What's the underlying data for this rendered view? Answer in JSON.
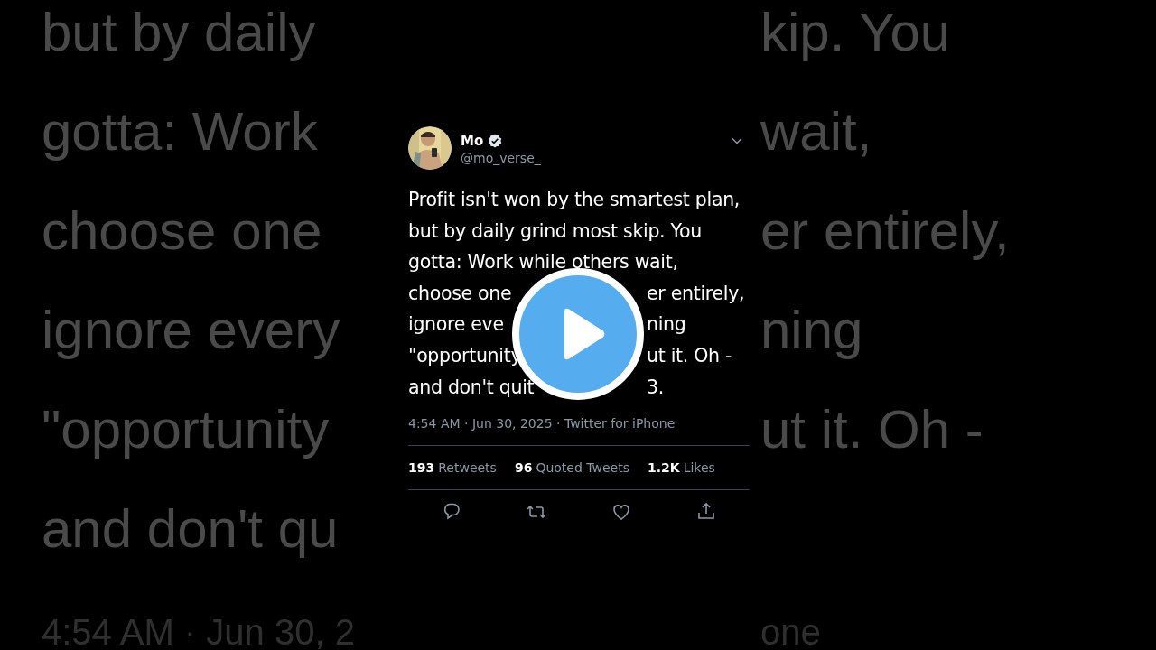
{
  "backdrop": {
    "left_lines": [
      "but by daily",
      "gotta: Work",
      "choose one",
      "ignore every",
      "\"opportunity",
      "and don't qu"
    ],
    "left_footer": "4:54 AM · Jun 30, 2",
    "right_lines": [
      "kip. You",
      "wait,",
      "er entirely,",
      "ning",
      "ut it. Oh -"
    ],
    "right_footer": "one"
  },
  "tweet": {
    "author": {
      "name": "Mo",
      "verified": true,
      "handle": "@mo_verse_"
    },
    "body_lines": [
      [
        "Profit isn't won by the smartest plan,"
      ],
      [
        "but by daily grind most skip. You"
      ],
      [
        "gotta: Work while others wait,"
      ],
      [
        "choose one",
        "er entirely,"
      ],
      [
        "ignore eve",
        "ning"
      ],
      [
        "\"opportunity",
        "ut it. Oh -"
      ],
      [
        "and don't quit",
        "3."
      ]
    ],
    "meta": "4:54 AM · Jun 30, 2025 · Twitter for iPhone",
    "stats": [
      {
        "count": "193",
        "label": "Retweets"
      },
      {
        "count": "96",
        "label": "Quoted Tweets"
      },
      {
        "count": "1.2K",
        "label": "Likes"
      }
    ],
    "actions": [
      {
        "kind": "reply"
      },
      {
        "kind": "retweet"
      },
      {
        "kind": "like"
      },
      {
        "kind": "share"
      }
    ]
  },
  "video": {
    "play_button": true
  }
}
